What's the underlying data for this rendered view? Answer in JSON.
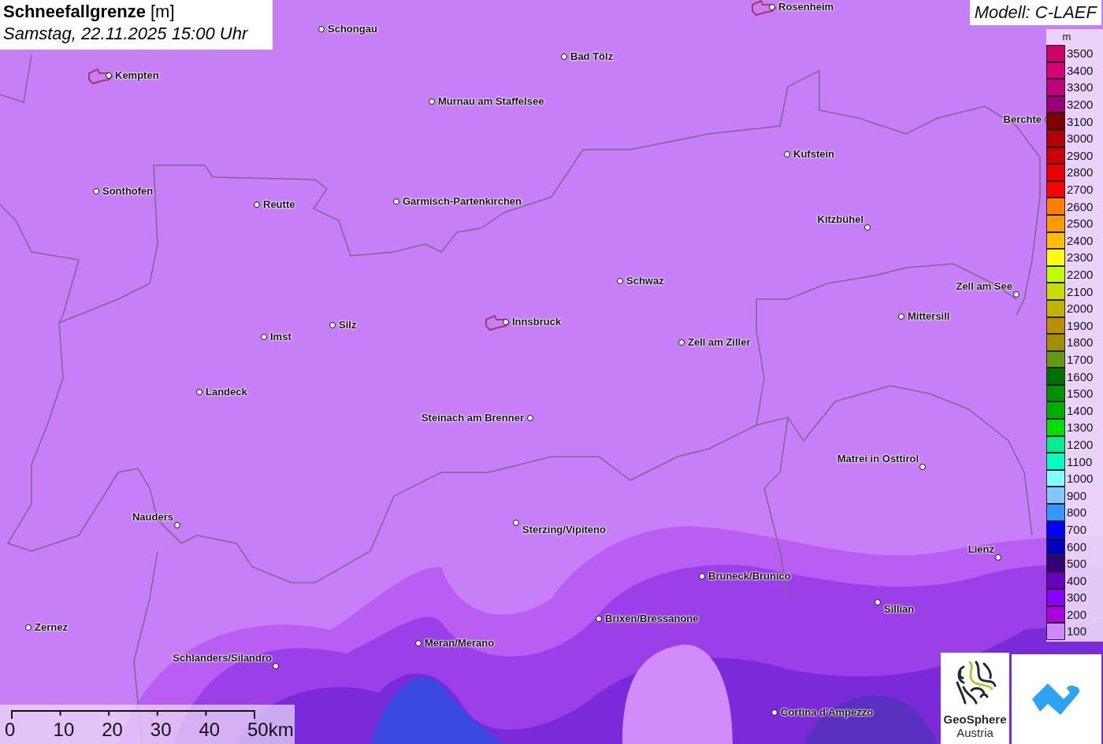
{
  "title": {
    "name": "Schneefallgrenze",
    "unit": "[m]",
    "time": "Samstag, 22.11.2025 15:00 Uhr"
  },
  "model": "Modell: C-LAEF",
  "cities": [
    {
      "name": "Rosenheim",
      "outlined": true
    },
    {
      "name": "Schongau",
      "outlined": false
    },
    {
      "name": "Bad Tölz",
      "outlined": false
    },
    {
      "name": "Kempten",
      "outlined": true
    },
    {
      "name": "Murnau am Staffelsee",
      "outlined": false
    },
    {
      "name": "Berchte",
      "outlined": false
    },
    {
      "name": "Kufstein",
      "outlined": false
    },
    {
      "name": "Sonthofen",
      "outlined": false
    },
    {
      "name": "Reutte",
      "outlined": false
    },
    {
      "name": "Garmisch-Partenkirchen",
      "outlined": false
    },
    {
      "name": "Kitzbühel",
      "outlined": false
    },
    {
      "name": "Schwaz",
      "outlined": false
    },
    {
      "name": "Zell am See",
      "outlined": false
    },
    {
      "name": "Mittersill",
      "outlined": false
    },
    {
      "name": "Innsbruck",
      "outlined": true
    },
    {
      "name": "Silz",
      "outlined": false
    },
    {
      "name": "Imst",
      "outlined": false
    },
    {
      "name": "Zell am Ziller",
      "outlined": false
    },
    {
      "name": "Landeck",
      "outlined": false
    },
    {
      "name": "Steinach am Brenner",
      "outlined": false
    },
    {
      "name": "Matrei in Osttirol",
      "outlined": false
    },
    {
      "name": "Nauders",
      "outlined": false
    },
    {
      "name": "Sterzing/Vipiteno",
      "outlined": false
    },
    {
      "name": "Lienz",
      "outlined": false
    },
    {
      "name": "Bruneck/Brunico",
      "outlined": false
    },
    {
      "name": "Sillian",
      "outlined": false
    },
    {
      "name": "Brixen/Bressanone",
      "outlined": false
    },
    {
      "name": "Zernez",
      "outlined": false
    },
    {
      "name": "Meran/Merano",
      "outlined": false
    },
    {
      "name": "Schlanders/Silandro",
      "outlined": false
    },
    {
      "name": "Cortina d'Ampezzo",
      "outlined": false
    }
  ],
  "legend": {
    "unit": "m",
    "items": [
      {
        "label": "3500",
        "color": "#cc0066"
      },
      {
        "label": "3400",
        "color": "#d6007a"
      },
      {
        "label": "3300",
        "color": "#c0007a"
      },
      {
        "label": "3200",
        "color": "#990077"
      },
      {
        "label": "3100",
        "color": "#800000"
      },
      {
        "label": "3000",
        "color": "#b30000"
      },
      {
        "label": "2900",
        "color": "#cc0000"
      },
      {
        "label": "2800",
        "color": "#e60000"
      },
      {
        "label": "2700",
        "color": "#ff0000"
      },
      {
        "label": "2600",
        "color": "#ff8000"
      },
      {
        "label": "2500",
        "color": "#ff9900"
      },
      {
        "label": "2400",
        "color": "#ffbf00"
      },
      {
        "label": "2300",
        "color": "#ffff00"
      },
      {
        "label": "2200",
        "color": "#bfff00"
      },
      {
        "label": "2100",
        "color": "#c8dc00"
      },
      {
        "label": "2000",
        "color": "#c0b400"
      },
      {
        "label": "1900",
        "color": "#b89000"
      },
      {
        "label": "1800",
        "color": "#a09000"
      },
      {
        "label": "1700",
        "color": "#609a10"
      },
      {
        "label": "1600",
        "color": "#007000"
      },
      {
        "label": "1500",
        "color": "#009000"
      },
      {
        "label": "1400",
        "color": "#00b000"
      },
      {
        "label": "1300",
        "color": "#00e000"
      },
      {
        "label": "1200",
        "color": "#00f090"
      },
      {
        "label": "1100",
        "color": "#00ffc0"
      },
      {
        "label": "1000",
        "color": "#80ffff"
      },
      {
        "label": "900",
        "color": "#80c8ff"
      },
      {
        "label": "800",
        "color": "#3399ff"
      },
      {
        "label": "700",
        "color": "#0000ff"
      },
      {
        "label": "600",
        "color": "#0000bb"
      },
      {
        "label": "500",
        "color": "#330077"
      },
      {
        "label": "400",
        "color": "#6600bb"
      },
      {
        "label": "300",
        "color": "#8800ff"
      },
      {
        "label": "200",
        "color": "#aa00dd"
      },
      {
        "label": "100",
        "color": "#cc88ff"
      }
    ]
  },
  "scale": {
    "ticks": [
      "0",
      "10",
      "20",
      "30",
      "40",
      "50km"
    ]
  },
  "logo": {
    "line1": "GeoSphere",
    "line2": "Austria"
  }
}
